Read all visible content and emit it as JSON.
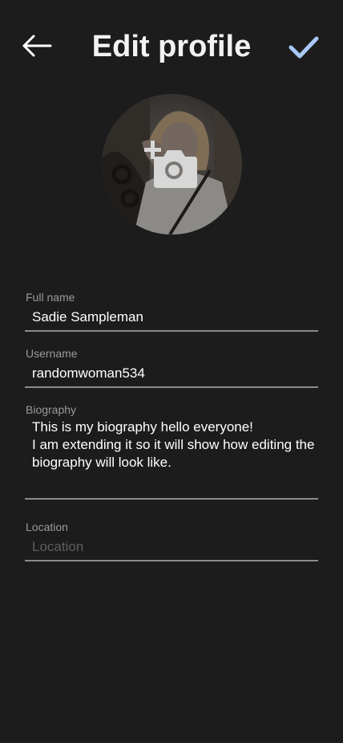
{
  "header": {
    "title": "Edit profile",
    "back_icon": "arrow-left-icon",
    "save_icon": "checkmark-icon",
    "accent_color": "#a9c8f5"
  },
  "avatar": {
    "change_photo_icon": "add-photo-camera-icon"
  },
  "form": {
    "full_name": {
      "label": "Full name",
      "value": "Sadie Sampleman"
    },
    "username": {
      "label": "Username",
      "value": "randomwoman534"
    },
    "biography": {
      "label": "Biography",
      "value": "This is my biography hello everyone!\nI am extending it so it will show how editing the biography will look like."
    },
    "location": {
      "label": "Location",
      "value": "",
      "placeholder": "Location"
    }
  }
}
